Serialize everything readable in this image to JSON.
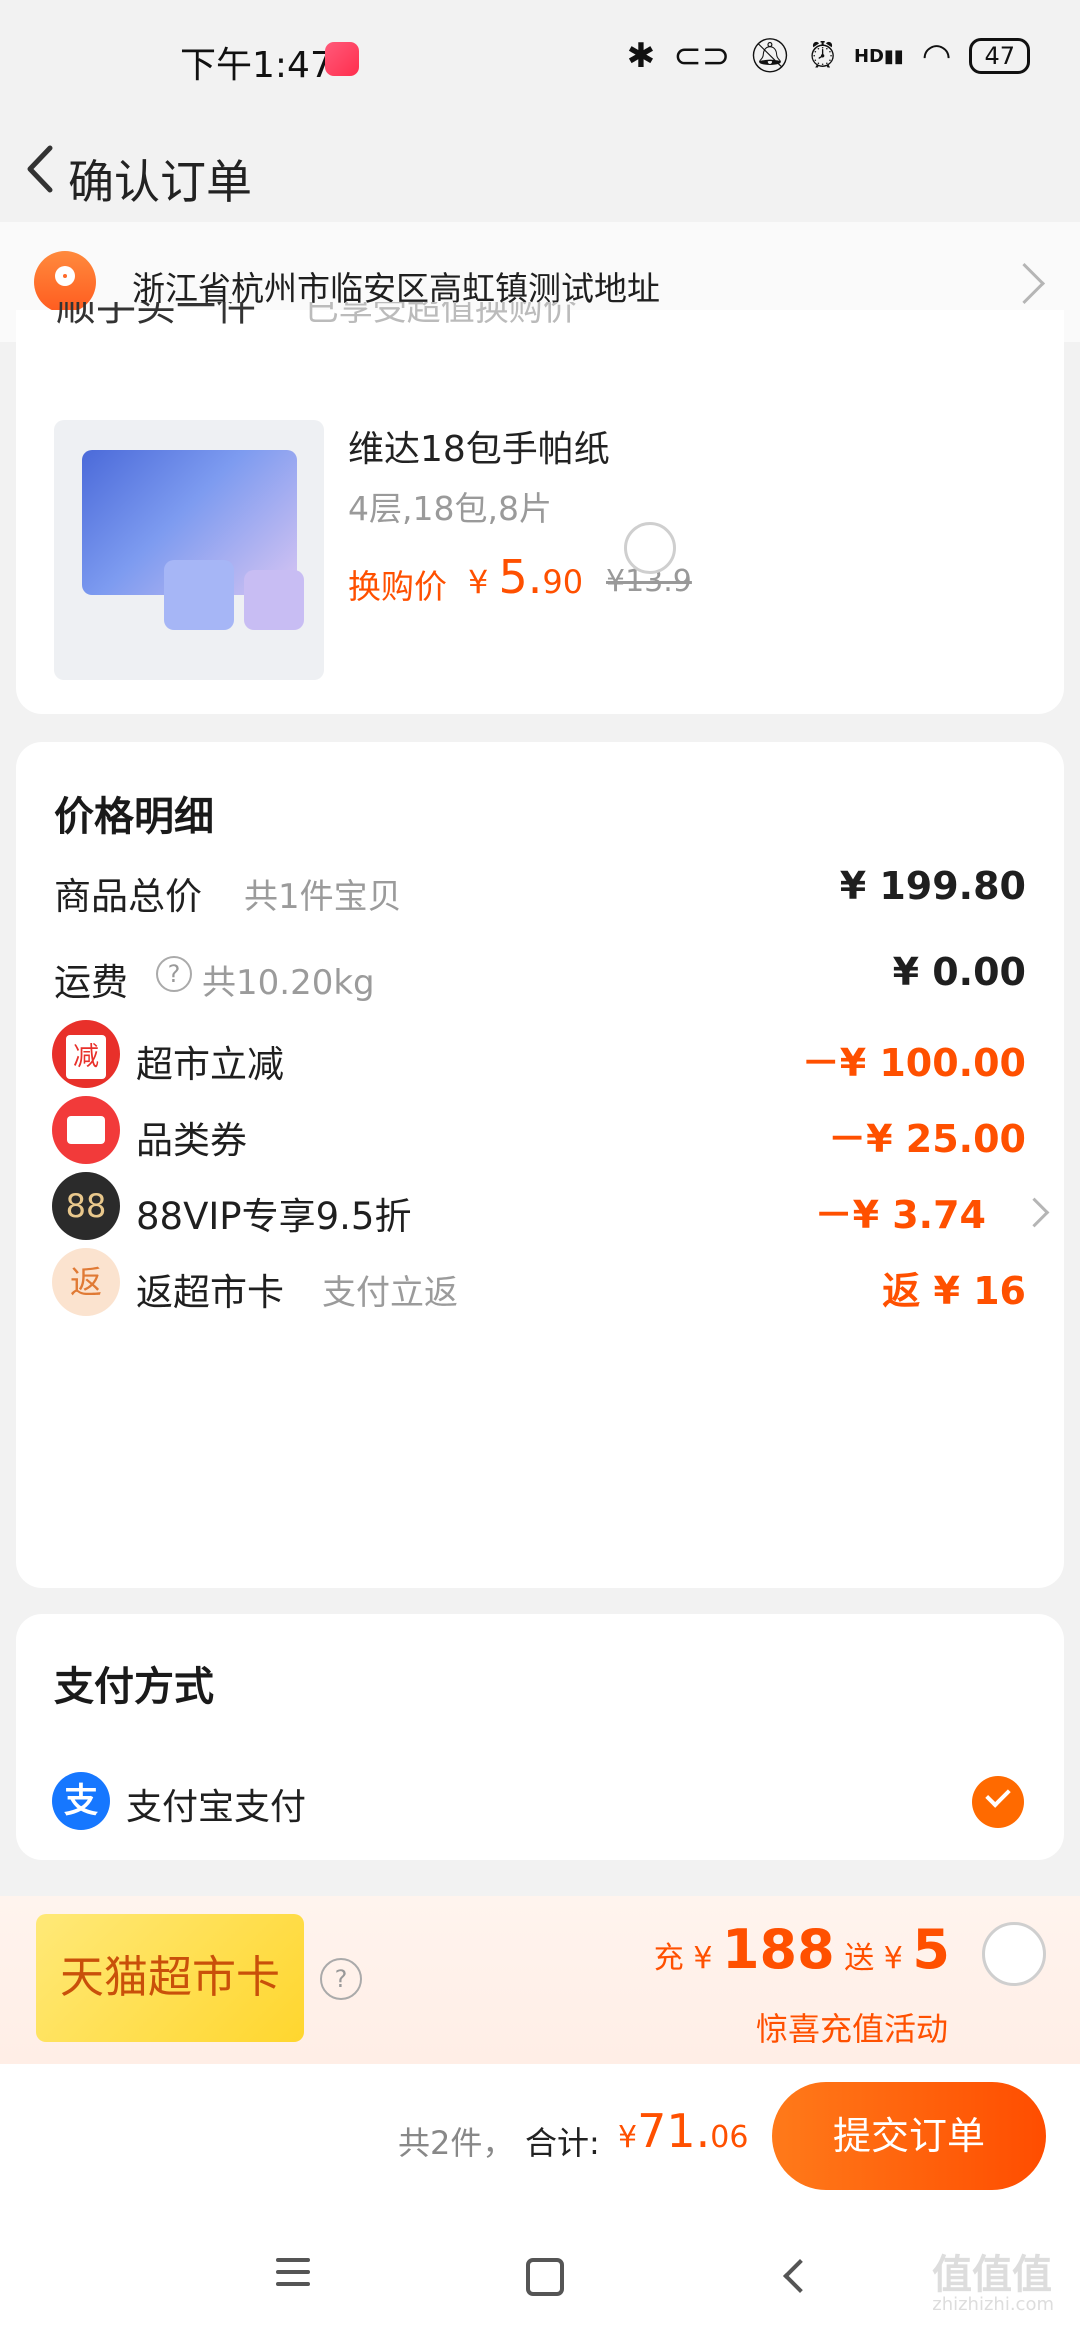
{
  "status_bar": {
    "time": "下午1:47",
    "battery": "47",
    "network": "HD"
  },
  "header": {
    "title": "确认订单"
  },
  "address": {
    "text": "浙江省杭州市临安区高虹镇测试地址"
  },
  "product": {
    "name": "维达18包手帕纸",
    "spec": "4层,18包,8片",
    "price_label": "换购价",
    "currency": "¥",
    "price_int": "5.",
    "price_dec": "90",
    "original_price": "¥13.9",
    "partial_header": "顺手买一件",
    "partial_header_sub": "已享受超值换购价"
  },
  "price_detail": {
    "title": "价格明细",
    "goods_total_label": "商品总价",
    "goods_total_sub": "共1件宝贝",
    "goods_total_value": "¥ 199.80",
    "shipping_label": "运费",
    "shipping_sub": "共10.20kg",
    "shipping_value": "¥ 0.00",
    "discounts": [
      {
        "badge": "减",
        "label": "超市立减",
        "sub": "",
        "value": "－¥ 100.00",
        "color": "#e8302a"
      },
      {
        "badge": "",
        "label": "品类券",
        "sub": "",
        "value": "－¥ 25.00",
        "color": "#f23a3a"
      },
      {
        "badge": "88",
        "label": "88VIP专享9.5折",
        "sub": "",
        "value": "－¥ 3.74",
        "color": "#2b2b2b"
      },
      {
        "badge": "返",
        "label": "返超市卡",
        "sub": "支付立返",
        "value": "返 ¥ 16",
        "color": "#fbe3cf"
      }
    ]
  },
  "payment": {
    "title": "支付方式",
    "method": "支付宝支付",
    "icon_char": "支"
  },
  "promo": {
    "card_label": "天猫超市卡",
    "charge_prefix": "充",
    "charge_currency": "¥",
    "charge_amount": "188",
    "gift_prefix": "送",
    "gift_currency": "¥",
    "gift_amount": "5",
    "subtitle": "惊喜充值活动"
  },
  "bottom": {
    "count": "共2件，",
    "total_label": "合计:",
    "currency": "¥",
    "total_int": "71.",
    "total_dec": "06",
    "submit_label": "提交订单"
  },
  "watermark": {
    "logo": "值值值",
    "url": "zhizhizhi.com"
  },
  "colors": {
    "accent": "#ff5000",
    "alipay": "#1677ff",
    "page_bg": "#f2f2f2"
  }
}
